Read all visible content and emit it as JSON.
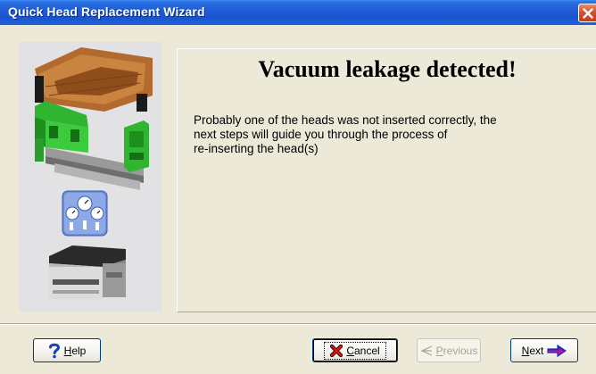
{
  "window": {
    "title": "Quick Head Replacement Wizard",
    "close_icon": "close-icon"
  },
  "content": {
    "heading": "Vacuum leakage detected!",
    "body_lines": [
      "Probably one of the heads was not inserted correctly, the",
      "next steps will guide you through the process of",
      "re-inserting the head(s)"
    ]
  },
  "illustrations": {
    "top": "print-head-assembly-image",
    "middle": "vacuum-gauges-icon",
    "bottom": "printer-unit-image"
  },
  "buttons": {
    "help": {
      "label": "Help",
      "accel": "H",
      "rest": "elp",
      "icon": "question-mark-icon",
      "enabled": true
    },
    "cancel": {
      "label": "Cancel",
      "accel": "C",
      "rest": "ancel",
      "icon": "red-x-icon",
      "enabled": true
    },
    "previous": {
      "label": "Previous",
      "accel": "P",
      "rest": "revious",
      "icon": "back-arrow-icon",
      "enabled": false
    },
    "next": {
      "label": "Next",
      "accel": "N",
      "rest": "ext",
      "icon": "right-arrow-icon",
      "enabled": true
    }
  },
  "colors": {
    "titlebar": "#1f5cd6",
    "window_bg": "#ece9d8",
    "close_button": "#d9502b",
    "head_green": "#2fb52f",
    "cable_brown": "#b2652c"
  }
}
